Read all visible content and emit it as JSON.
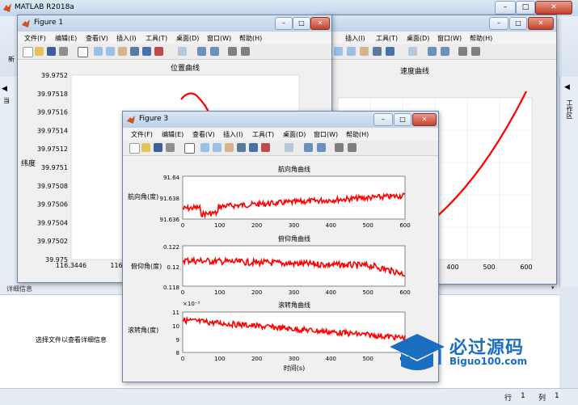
{
  "app": {
    "title": "MATLAB R2018a"
  },
  "matlab": {
    "detail_header": "详细信息",
    "detail_text": "选择文件以查看详细信息",
    "status": {
      "row_label": "行",
      "row_value": "1",
      "col_label": "列",
      "col_value": "1"
    },
    "side_left_char": "当",
    "side_right_label": "工作区",
    "toolstrip_char": "新"
  },
  "menu": [
    "文件(F)",
    "编辑(E)",
    "查看(V)",
    "插入(I)",
    "工具(T)",
    "桌面(D)",
    "窗口(W)",
    "帮助(H)"
  ],
  "figure1": {
    "title": "Figure 1",
    "plot_title": "位置曲线",
    "ylabel": "纬度",
    "yticks": [
      "39.9752",
      "39.97518",
      "39.97516",
      "39.97514",
      "39.97512",
      "39.9751",
      "39.97508",
      "39.97506",
      "39.97504",
      "39.97502",
      "39.975"
    ],
    "xticks": [
      "116.3446",
      "116"
    ]
  },
  "figure2": {
    "title": "速度曲线",
    "xticks": [
      "400",
      "500",
      "600"
    ],
    "menu_visible": [
      "插入(I)",
      "工具(T)",
      "桌面(D)",
      "窗口(W)",
      "帮助(H)"
    ]
  },
  "figure3": {
    "title": "Figure 3",
    "subplots": [
      {
        "title": "航向角曲线",
        "ylabel": "航向角(度)",
        "yticks": [
          "91.64",
          "91.638",
          "91.636"
        ]
      },
      {
        "title": "俯仰角曲线",
        "ylabel": "俯仰角(度)",
        "yticks": [
          "0.122",
          "0.12",
          "0.118"
        ]
      },
      {
        "title": "滚转角曲线",
        "ylabel": "滚转角(度)",
        "yticks": [
          "11",
          "10",
          "9",
          "8"
        ],
        "exponent": "×10⁻³"
      }
    ],
    "xticks": [
      "0",
      "100",
      "200",
      "300",
      "400",
      "500",
      "600"
    ],
    "xlabel": "时间(s)"
  },
  "watermark": {
    "cn": "必过源码",
    "en": "Biguo100.com"
  },
  "colors": {
    "line": "#ff0000",
    "titlebar": "#c9dcf0",
    "watermark": "#1a6fc3"
  }
}
